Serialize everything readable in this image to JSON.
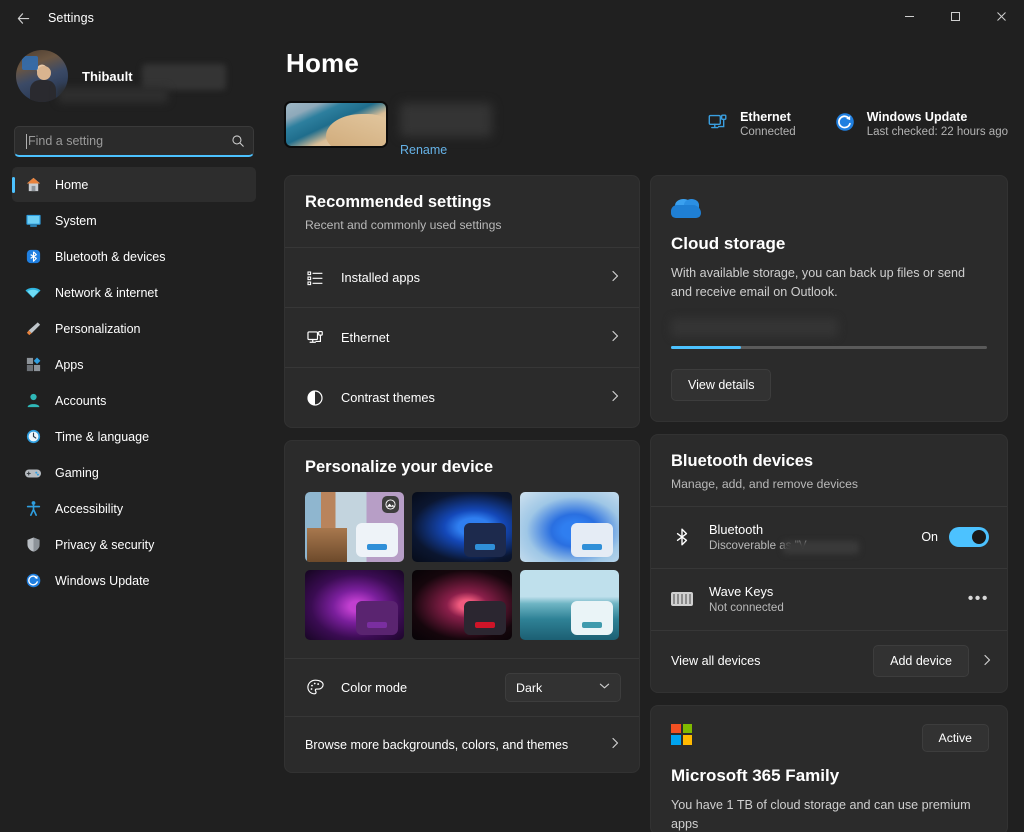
{
  "window": {
    "title": "Settings",
    "back_icon": "back-arrow-icon",
    "minimize": "–",
    "maximize": "□",
    "close": "✕"
  },
  "sidebar": {
    "profile": {
      "name": "Thibault",
      "name_redacted": true
    },
    "search": {
      "placeholder": "Find a setting",
      "value": "",
      "icon": "search-icon"
    },
    "items": [
      {
        "label": "Home",
        "icon": "home-icon",
        "active": true
      },
      {
        "label": "System",
        "icon": "system-icon",
        "active": false
      },
      {
        "label": "Bluetooth & devices",
        "icon": "bluetooth-icon",
        "active": false
      },
      {
        "label": "Network & internet",
        "icon": "wifi-icon",
        "active": false
      },
      {
        "label": "Personalization",
        "icon": "paintbrush-icon",
        "active": false
      },
      {
        "label": "Apps",
        "icon": "apps-icon",
        "active": false
      },
      {
        "label": "Accounts",
        "icon": "person-icon",
        "active": false
      },
      {
        "label": "Time & language",
        "icon": "clock-icon",
        "active": false
      },
      {
        "label": "Gaming",
        "icon": "gamepad-icon",
        "active": false
      },
      {
        "label": "Accessibility",
        "icon": "accessibility-icon",
        "active": false
      },
      {
        "label": "Privacy & security",
        "icon": "shield-icon",
        "active": false
      },
      {
        "label": "Windows Update",
        "icon": "update-icon",
        "active": false
      }
    ]
  },
  "main": {
    "page_title": "Home",
    "device": {
      "name_redacted": true,
      "rename_label": "Rename"
    },
    "status": [
      {
        "title": "Ethernet",
        "subtitle": "Connected",
        "icon": "ethernet-icon"
      },
      {
        "title": "Windows Update",
        "subtitle": "Last checked: 22 hours ago",
        "icon": "update-icon"
      }
    ],
    "recommended": {
      "title": "Recommended settings",
      "subtitle": "Recent and commonly used settings",
      "rows": [
        {
          "label": "Installed apps",
          "icon": "list-icon"
        },
        {
          "label": "Ethernet",
          "icon": "ethernet-icon"
        },
        {
          "label": "Contrast themes",
          "icon": "contrast-icon"
        }
      ]
    },
    "personalize": {
      "title": "Personalize your device",
      "wallpapers": [
        {
          "name": "theme-windows-spotlight",
          "badge_icon": "spotlight-icon",
          "bar_color": "#2f8fd8",
          "preview_bg": "#eef3f8"
        },
        {
          "name": "theme-windows-dark",
          "bar_color": "#2f8fd8",
          "preview_bg": "#1d2a4d"
        },
        {
          "name": "theme-windows-light",
          "bar_color": "#2f8fd8",
          "preview_bg": "#e5ecf5"
        },
        {
          "name": "theme-glow-dark",
          "bar_color": "#7a2ea0",
          "preview_bg": "#3a1550"
        },
        {
          "name": "theme-flow-dark",
          "bar_color": "#cf1428",
          "preview_bg": "#2b2630"
        },
        {
          "name": "theme-captured-motion",
          "bar_color": "#3f9aad",
          "preview_bg": "#eaf4f7"
        }
      ],
      "color_mode": {
        "label": "Color mode",
        "icon": "palette-icon",
        "value": "Dark",
        "chevron": "⌄"
      },
      "browse_label": "Browse more backgrounds, colors, and themes"
    },
    "cloud_storage": {
      "icon": "onedrive-cloud-icon",
      "title": "Cloud storage",
      "description": "With available storage, you can back up files or send and receive email on Outlook.",
      "usage_redacted": true,
      "progress_percent": 22,
      "button_label": "View details"
    },
    "bluetooth": {
      "title": "Bluetooth devices",
      "subtitle": "Manage, add, and remove devices",
      "toggle_row": {
        "name": "Bluetooth",
        "subtitle": "Discoverable as \"V",
        "subtitle_redacted": true,
        "state_label": "On",
        "state_on": true,
        "icon": "bluetooth-icon"
      },
      "devices": [
        {
          "name": "Wave Keys",
          "status": "Not connected",
          "icon": "keyboard-icon",
          "menu": "•••"
        }
      ],
      "footer": {
        "link_label": "View all devices",
        "button_label": "Add device",
        "chevron": "›"
      }
    },
    "microsoft365": {
      "logo": "microsoft-logo",
      "badge": "Active",
      "title": "Microsoft 365 Family",
      "description": "You have 1 TB of cloud storage and can use premium apps"
    }
  },
  "colors": {
    "accent": "#4cc2ff",
    "page_bg": "#202020",
    "card_bg": "#2b2b2b",
    "link": "#66b3e8",
    "ms_red": "#f25022",
    "ms_green": "#7fba00",
    "ms_blue": "#00a4ef",
    "ms_yellow": "#ffb900"
  }
}
